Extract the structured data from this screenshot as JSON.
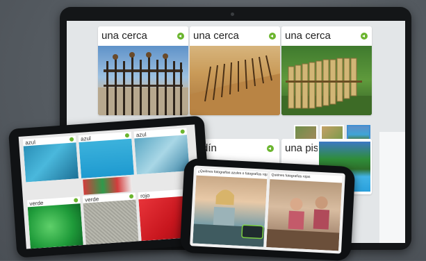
{
  "laptop": {
    "cards": [
      {
        "label": "una cerca",
        "icon": "play-audio-icon"
      },
      {
        "label": "una cerca",
        "icon": "play-audio-icon"
      },
      {
        "label": "una cerca",
        "icon": "play-audio-icon"
      }
    ],
    "lower_cards": [
      {
        "label": "rdín",
        "icon": "play-audio-icon"
      },
      {
        "label": "una pis",
        "icon": "play-audio-icon"
      }
    ]
  },
  "tablet": {
    "tiles": [
      {
        "label": "azul"
      },
      {
        "label": "azul"
      },
      {
        "label": "azul"
      },
      {
        "label": "verde"
      },
      {
        "label": "verde"
      },
      {
        "label": "rojo"
      }
    ]
  },
  "phone": {
    "question_left": "¿Quiénes fotografías azules o fotografías rojas?",
    "question_right": "Quiénes fotografías rojas"
  },
  "colors": {
    "accent_green": "#6bb52f",
    "selected_blue": "#3f8fd2"
  }
}
